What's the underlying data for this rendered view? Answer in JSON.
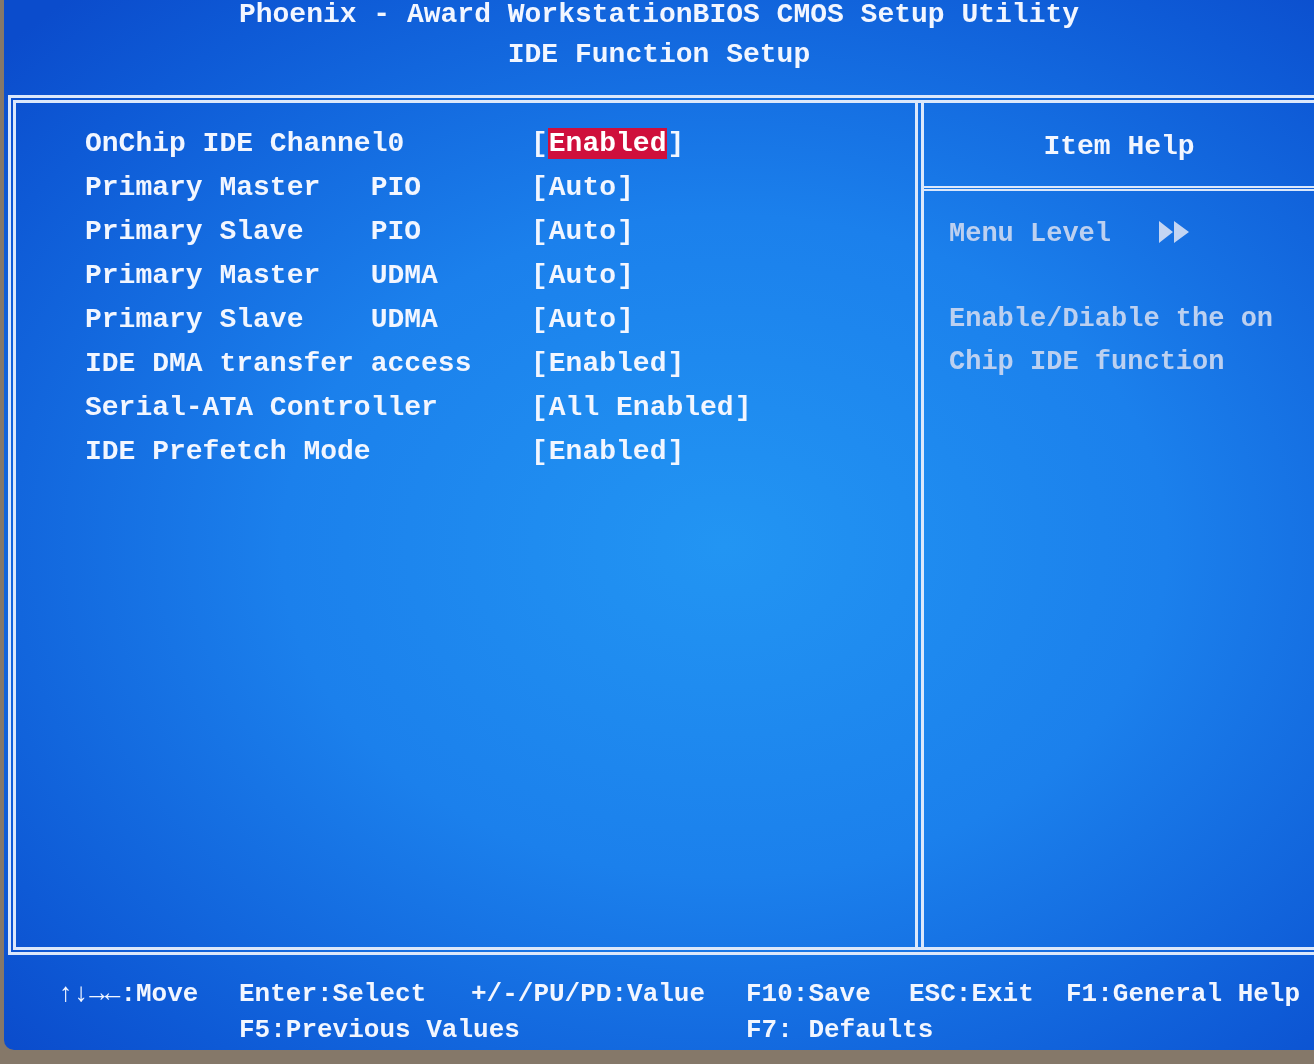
{
  "header": {
    "title": "Phoenix - Award WorkstationBIOS CMOS Setup Utility",
    "subtitle": "IDE Function Setup"
  },
  "settings": [
    {
      "label": "OnChip IDE Channel0",
      "brackets": [
        "[",
        "]"
      ],
      "value": "Enabled",
      "selected": true
    },
    {
      "label": "Primary Master",
      "mode": "PIO",
      "brackets": [
        "[",
        "]"
      ],
      "value": "Auto",
      "selected": false
    },
    {
      "label": "Primary Slave",
      "mode": "PIO",
      "brackets": [
        "[",
        "]"
      ],
      "value": "Auto",
      "selected": false
    },
    {
      "label": "Primary Master",
      "mode": "UDMA",
      "brackets": [
        "[",
        "]"
      ],
      "value": "Auto",
      "selected": false
    },
    {
      "label": "Primary Slave",
      "mode": "UDMA",
      "brackets": [
        "[",
        "]"
      ],
      "value": "Auto",
      "selected": false
    },
    {
      "label": "IDE DMA transfer access",
      "brackets": [
        "[",
        "]"
      ],
      "value": "Enabled",
      "selected": false
    },
    {
      "label": "Serial-ATA Controller",
      "brackets": [
        "[",
        "]"
      ],
      "value": "All Enabled",
      "selected": false
    },
    {
      "label": "IDE Prefetch Mode",
      "brackets": [
        "[",
        "]"
      ],
      "value": "Enabled",
      "selected": false
    }
  ],
  "help": {
    "title": "Item Help",
    "menu_level": "Menu Level",
    "text": "Enable/Diable the on Chip IDE function"
  },
  "key_hints": [
    [
      "↑↓→←:Move",
      "Enter:Select",
      "+/-/PU/PD:Value",
      "F10:Save",
      "ESC:Exit",
      "F1:General Help"
    ],
    [
      "F5:Previous Values",
      "F7: Defaults"
    ]
  ]
}
